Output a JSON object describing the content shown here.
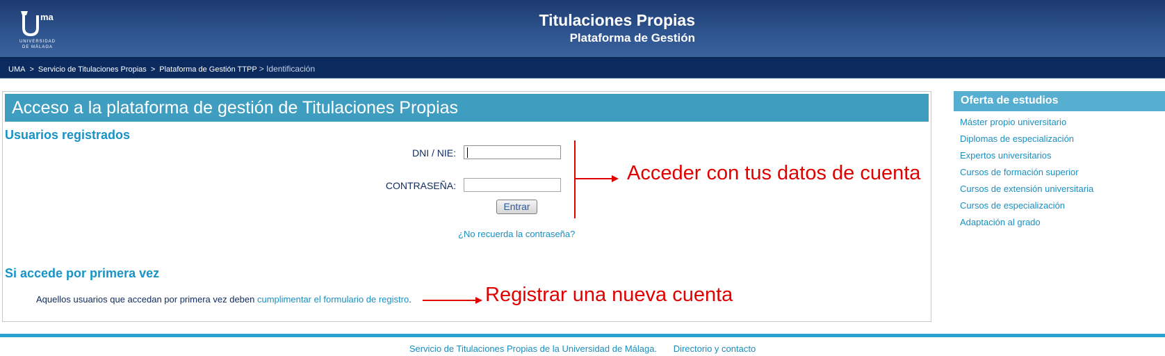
{
  "header": {
    "logo_text": "UNIVERSIDAD DE MÁLAGA",
    "logo_mark": "ma",
    "title": "Titulaciones Propias",
    "subtitle": "Plataforma de Gestión"
  },
  "breadcrumb": {
    "items": [
      "UMA",
      "Servicio de Titulaciones Propias",
      "Plataforma de Gestión TTPP"
    ],
    "separator": ">",
    "current": "> Identificación"
  },
  "main": {
    "title": "Acceso a la plataforma de gestión de Titulaciones Propias",
    "registered_heading": "Usuarios registrados",
    "dni_label": "DNI / NIE:",
    "dni_value": "",
    "password_label": "CONTRASEÑA:",
    "password_value": "",
    "submit_label": "Entrar",
    "forgot_link": "¿No recuerda la contraseña?",
    "first_time_heading": "Si accede por primera vez",
    "register_text": "Aquellos usuarios que accedan por primera vez deben ",
    "register_link": "cumplimentar el formulario de registro",
    "register_end": "."
  },
  "annotations": {
    "login": "Acceder con tus datos de cuenta",
    "register": "Registrar una nueva cuenta",
    "color": "#e00000"
  },
  "sidebar": {
    "title": "Oferta de estudios",
    "items": [
      "Máster propio universitario",
      "Diplomas de especialización",
      "Expertos universitarios",
      "Cursos de formación superior",
      "Cursos de extensión universitaria",
      "Cursos de especialización",
      "Adaptación al grado"
    ]
  },
  "footer": {
    "service_link": "Servicio de Titulaciones Propias de la Universidad de Málaga.",
    "contact_link": "Directorio y contacto"
  },
  "colors": {
    "header_bg": "#2f5590",
    "breadcrumb_bg": "#0b2a5e",
    "title_bar": "#3f9ec0",
    "link": "#1a8fbf",
    "heading": "#1793c7"
  }
}
